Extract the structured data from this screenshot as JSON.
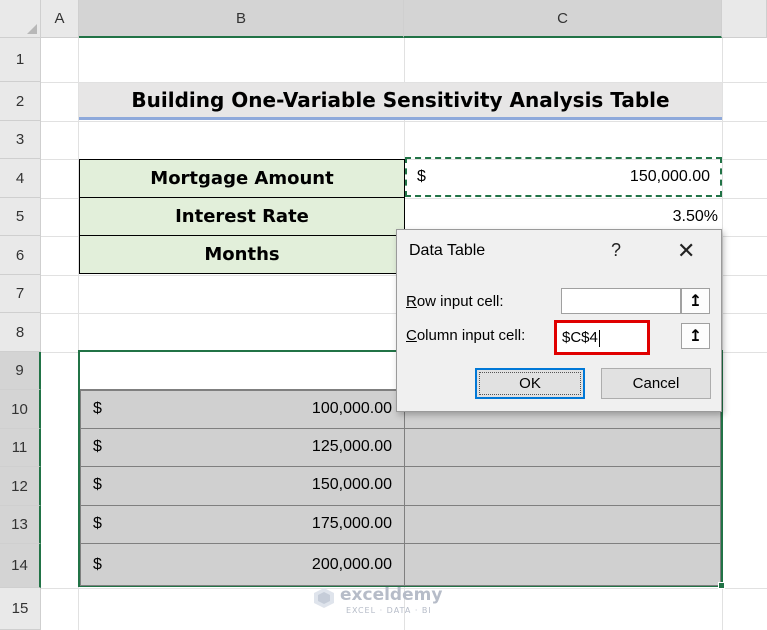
{
  "columns": [
    "A",
    "B",
    "C"
  ],
  "rows": [
    "1",
    "2",
    "3",
    "4",
    "5",
    "6",
    "7",
    "8",
    "9",
    "10",
    "11",
    "12",
    "13",
    "14",
    "15"
  ],
  "title": "Building One-Variable Sensitivity Analysis Table",
  "labels": {
    "mortgage": "Mortgage Amount",
    "interest": "Interest Rate",
    "months": "Months"
  },
  "values": {
    "mortgage_currency": "$",
    "mortgage_amount": "150,000.00",
    "interest_rate": "3.50%"
  },
  "sensitivity_table": [
    {
      "currency": "$",
      "amount": "100,000.00"
    },
    {
      "currency": "$",
      "amount": "125,000.00"
    },
    {
      "currency": "$",
      "amount": "150,000.00"
    },
    {
      "currency": "$",
      "amount": "175,000.00"
    },
    {
      "currency": "$",
      "amount": "200,000.00"
    }
  ],
  "dialog": {
    "title": "Data Table",
    "help": "?",
    "close": "✕",
    "row_label_u": "R",
    "row_label_rest": "ow input cell:",
    "row_value": "",
    "col_label_u": "C",
    "col_label_rest": "olumn input cell:",
    "col_value": "$C$4",
    "pick_icon": "↥",
    "ok": "OK",
    "cancel": "Cancel"
  },
  "watermark": {
    "brand": "exceldemy",
    "tagline": "EXCEL · DATA · BI"
  }
}
